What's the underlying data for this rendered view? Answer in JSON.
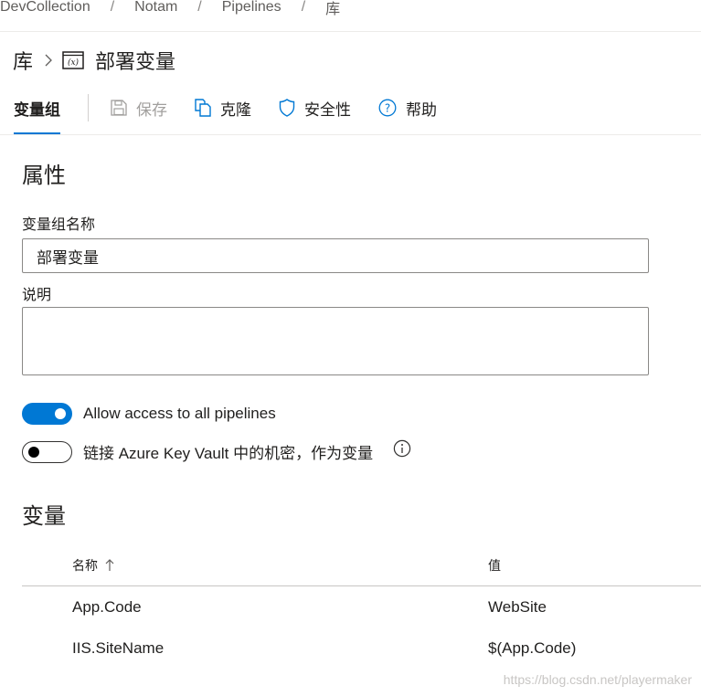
{
  "breadcrumb": {
    "items": [
      "DevCollection",
      "Notam",
      "Pipelines",
      "库"
    ],
    "separator": "/"
  },
  "header": {
    "library": "库",
    "title": "部署变量",
    "icons": {
      "chevron": "chevron-right-icon",
      "variable": "variable-group-icon"
    }
  },
  "toolbar": {
    "tab": "变量组",
    "save": "保存",
    "clone": "克隆",
    "security": "安全性",
    "help": "帮助",
    "icons": {
      "save": "save-icon",
      "clone": "clone-icon",
      "security": "shield-icon",
      "help": "help-circle-icon"
    }
  },
  "properties": {
    "title": "属性",
    "name_label": "变量组名称",
    "name_value": "部署变量",
    "desc_label": "说明",
    "desc_value": ""
  },
  "toggles": {
    "allow_access": {
      "label": "Allow access to all pipelines",
      "on": true
    },
    "key_vault": {
      "label": "链接 Azure Key Vault 中的机密，作为变量",
      "on": false,
      "info_icon": "info-icon"
    }
  },
  "variables": {
    "title": "变量",
    "columns": {
      "name": "名称",
      "value": "值",
      "sort_icon": "sort-ascending-icon"
    },
    "rows": [
      {
        "name": "App.Code",
        "value": "WebSite"
      },
      {
        "name": "IIS.SiteName",
        "value": "$(App.Code)"
      }
    ]
  },
  "watermark": "https://blog.csdn.net/playermaker",
  "colors": {
    "accent": "#0078d4",
    "text": "#201f1e",
    "disabled": "#a19f9d",
    "border": "#8a8886"
  }
}
